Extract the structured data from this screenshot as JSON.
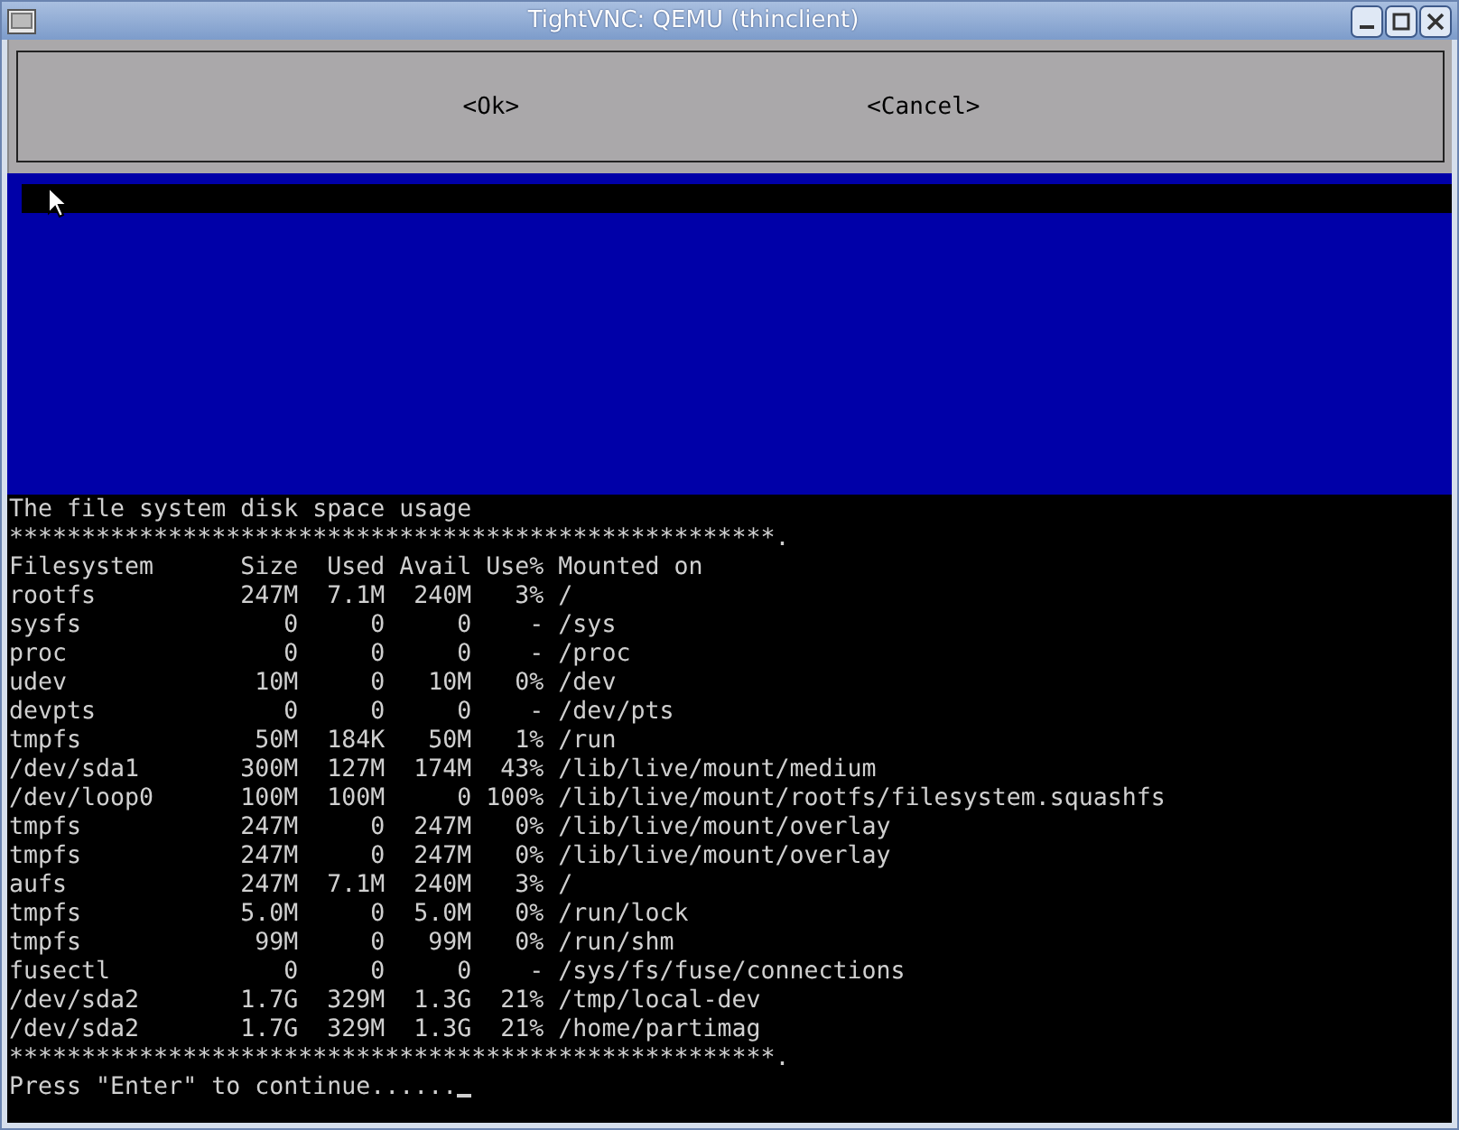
{
  "window": {
    "title": "TightVNC: QEMU (thinclient)"
  },
  "dialog": {
    "buttons": [
      {
        "label": "<Ok>"
      },
      {
        "label": "<Cancel>"
      }
    ]
  },
  "terminal": {
    "heading": "The file system disk space usage",
    "rule_top": "*****************************************************.",
    "table": {
      "columns": [
        "Filesystem",
        "Size",
        "Used",
        "Avail",
        "Use%",
        "Mounted on"
      ],
      "rows": [
        [
          "rootfs",
          "247M",
          "7.1M",
          "240M",
          "3%",
          "/"
        ],
        [
          "sysfs",
          "0",
          "0",
          "0",
          "-",
          "/sys"
        ],
        [
          "proc",
          "0",
          "0",
          "0",
          "-",
          "/proc"
        ],
        [
          "udev",
          "10M",
          "0",
          "10M",
          "0%",
          "/dev"
        ],
        [
          "devpts",
          "0",
          "0",
          "0",
          "-",
          "/dev/pts"
        ],
        [
          "tmpfs",
          "50M",
          "184K",
          "50M",
          "1%",
          "/run"
        ],
        [
          "/dev/sda1",
          "300M",
          "127M",
          "174M",
          "43%",
          "/lib/live/mount/medium"
        ],
        [
          "/dev/loop0",
          "100M",
          "100M",
          "0",
          "100%",
          "/lib/live/mount/rootfs/filesystem.squashfs"
        ],
        [
          "tmpfs",
          "247M",
          "0",
          "247M",
          "0%",
          "/lib/live/mount/overlay"
        ],
        [
          "tmpfs",
          "247M",
          "0",
          "247M",
          "0%",
          "/lib/live/mount/overlay"
        ],
        [
          "aufs",
          "247M",
          "7.1M",
          "240M",
          "3%",
          "/"
        ],
        [
          "tmpfs",
          "5.0M",
          "0",
          "5.0M",
          "0%",
          "/run/lock"
        ],
        [
          "tmpfs",
          "99M",
          "0",
          "99M",
          "0%",
          "/run/shm"
        ],
        [
          "fusectl",
          "0",
          "0",
          "0",
          "-",
          "/sys/fs/fuse/connections"
        ],
        [
          "/dev/sda2",
          "1.7G",
          "329M",
          "1.3G",
          "21%",
          "/tmp/local-dev"
        ],
        [
          "/dev/sda2",
          "1.7G",
          "329M",
          "1.3G",
          "21%",
          "/home/partimag"
        ]
      ]
    },
    "rule_bottom": "*****************************************************.",
    "prompt": "Press \"Enter\" to continue......"
  }
}
